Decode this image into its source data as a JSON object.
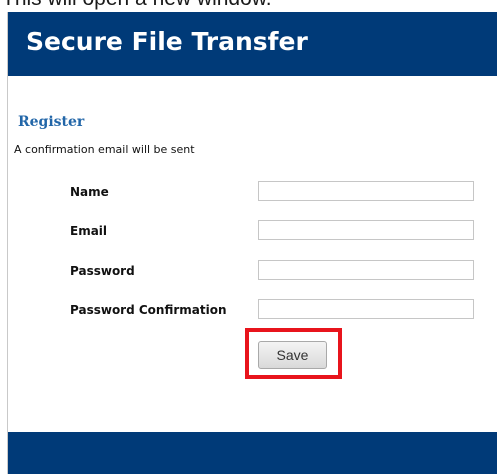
{
  "caption": {
    "text": "This will open a new window."
  },
  "header": {
    "title": "Secure File Transfer",
    "color": "#003a78"
  },
  "register": {
    "title": "Register",
    "subtitle": "A confirmation email will be sent"
  },
  "form": {
    "fields": [
      {
        "label": "Name",
        "value": "",
        "type": "text"
      },
      {
        "label": "Email",
        "value": "",
        "type": "email"
      },
      {
        "label": "Password",
        "value": "",
        "type": "password"
      },
      {
        "label": "Password Confirmation",
        "value": "",
        "type": "password"
      }
    ],
    "save_label": "Save",
    "highlight_color": "#e8141c"
  }
}
